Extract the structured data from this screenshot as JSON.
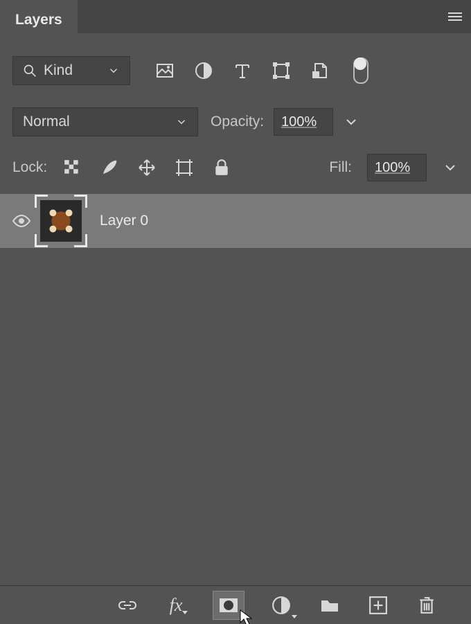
{
  "panel": {
    "tab": "Layers"
  },
  "filter": {
    "kind": "Kind"
  },
  "blend": {
    "mode": "Normal",
    "opacity_label": "Opacity:",
    "opacity_value": "100%"
  },
  "lock": {
    "label": "Lock:",
    "fill_label": "Fill:",
    "fill_value": "100%"
  },
  "layers": [
    {
      "name": "Layer 0"
    }
  ]
}
